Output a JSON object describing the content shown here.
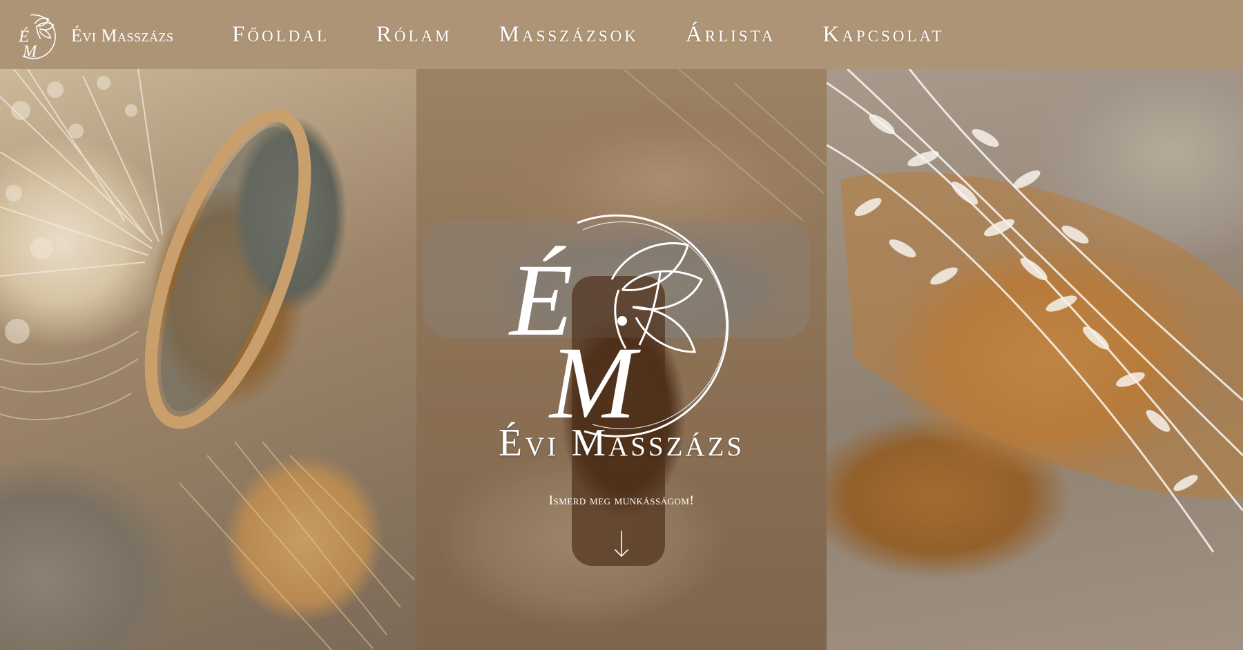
{
  "brand": {
    "name": "Évi Masszázs",
    "logo_icon": "em-lotus-logo-icon"
  },
  "nav": {
    "items": [
      {
        "label": "Főoldal"
      },
      {
        "label": "Rólam"
      },
      {
        "label": "Masszázsok"
      },
      {
        "label": "Árlista"
      },
      {
        "label": "Kapcsolat"
      }
    ]
  },
  "hero": {
    "logo_icon": "em-lotus-logo-icon",
    "title": "Évi Masszázs",
    "subtitle": "Ismerd meg munkásságom!",
    "scroll_icon": "arrow-down-icon"
  },
  "colors": {
    "navbar": "#ae9476",
    "text": "#ffffff"
  }
}
